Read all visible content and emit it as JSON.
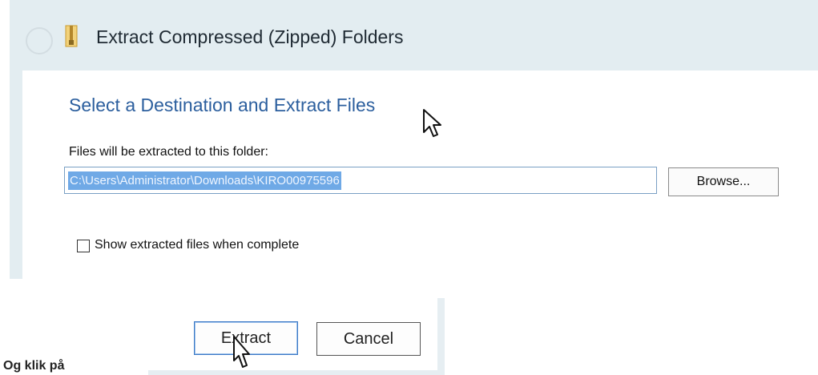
{
  "window": {
    "title": "Extract Compressed (Zipped) Folders"
  },
  "main": {
    "heading": "Select a Destination and Extract Files",
    "destination_label": "Files will be extracted to this folder:",
    "destination_path": "C:\\Users\\Administrator\\Downloads\\KIRO00975596",
    "browse_label": "Browse...",
    "show_files_checkbox": {
      "label": "Show extracted files when complete",
      "checked": false
    }
  },
  "footer": {
    "extract_label": "Extract",
    "cancel_label": "Cancel"
  },
  "caption": "Og klik på",
  "colors": {
    "accent": "#2c5f9e",
    "selection": "#6fa9e6",
    "dialog_frame": "#e3edf1"
  },
  "icons": [
    "back-arrow-icon",
    "zip-folder-icon",
    "mouse-pointer-icon"
  ]
}
